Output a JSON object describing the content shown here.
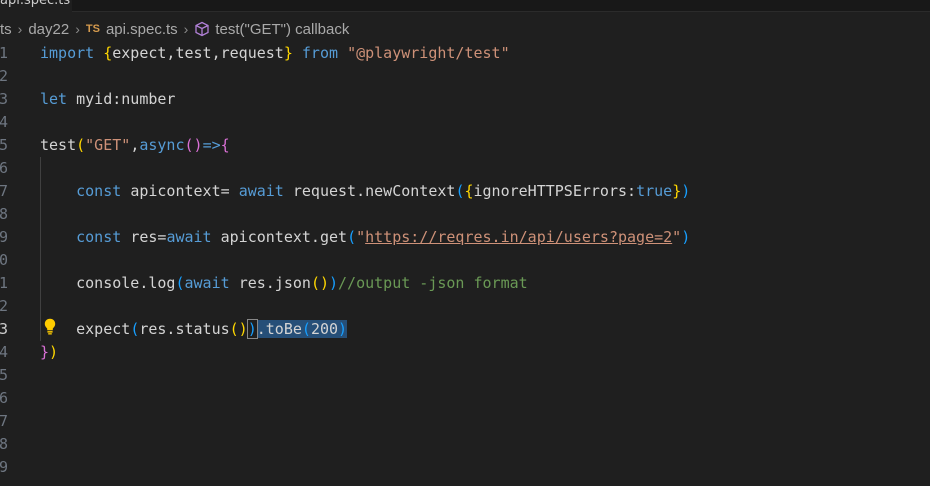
{
  "tab": {
    "label": "api.spec.ts"
  },
  "breadcrumb": {
    "items": [
      {
        "label": "ts"
      },
      {
        "label": "day22"
      },
      {
        "label": "api.spec.ts",
        "badge": "TS"
      },
      {
        "label": "test(\"GET\") callback"
      }
    ],
    "separator": "›"
  },
  "editor": {
    "line_numbers": [
      "1",
      "2",
      "3",
      "4",
      "5",
      "6",
      "7",
      "8",
      "9",
      "0",
      "1",
      "2",
      "3",
      "4",
      "5",
      "6",
      "7",
      "8",
      "9"
    ],
    "current_line_index": 12,
    "lines": [
      {
        "tokens": [
          {
            "t": "import ",
            "c": "kw"
          },
          {
            "t": "{",
            "c": "br1"
          },
          {
            "t": "expect,test,request",
            "c": "plain"
          },
          {
            "t": "}",
            "c": "br1"
          },
          {
            "t": " from ",
            "c": "kw"
          },
          {
            "t": "\"@playwright/test\"",
            "c": "str"
          }
        ]
      },
      {
        "tokens": []
      },
      {
        "tokens": [
          {
            "t": "let ",
            "c": "kw"
          },
          {
            "t": "myid:number",
            "c": "plain"
          }
        ]
      },
      {
        "tokens": []
      },
      {
        "tokens": [
          {
            "t": "test",
            "c": "plain"
          },
          {
            "t": "(",
            "c": "br1"
          },
          {
            "t": "\"GET\"",
            "c": "str"
          },
          {
            "t": ",",
            "c": "plain"
          },
          {
            "t": "async",
            "c": "kw"
          },
          {
            "t": "()",
            "c": "br2"
          },
          {
            "t": "=>",
            "c": "kw"
          },
          {
            "t": "{",
            "c": "br2"
          }
        ]
      },
      {
        "tokens": []
      },
      {
        "tokens": [
          {
            "t": "    const ",
            "c": "kw"
          },
          {
            "t": "apicontext= ",
            "c": "plain"
          },
          {
            "t": "await ",
            "c": "kw"
          },
          {
            "t": "request.newContext",
            "c": "plain"
          },
          {
            "t": "(",
            "c": "br3"
          },
          {
            "t": "{",
            "c": "br1"
          },
          {
            "t": "ignoreHTTPSErrors:",
            "c": "plain"
          },
          {
            "t": "true",
            "c": "bool"
          },
          {
            "t": "}",
            "c": "br1"
          },
          {
            "t": ")",
            "c": "br3"
          }
        ]
      },
      {
        "tokens": []
      },
      {
        "tokens": [
          {
            "t": "    const ",
            "c": "kw"
          },
          {
            "t": "res=",
            "c": "plain"
          },
          {
            "t": "await ",
            "c": "kw"
          },
          {
            "t": "apicontext.get",
            "c": "plain"
          },
          {
            "t": "(",
            "c": "br3"
          },
          {
            "t": "\"",
            "c": "str"
          },
          {
            "t": "https://reqres.in/api/users?page=2",
            "c": "url"
          },
          {
            "t": "\"",
            "c": "str"
          },
          {
            "t": ")",
            "c": "br3"
          }
        ]
      },
      {
        "tokens": []
      },
      {
        "tokens": [
          {
            "t": "    console.log",
            "c": "plain"
          },
          {
            "t": "(",
            "c": "br3"
          },
          {
            "t": "await ",
            "c": "kw"
          },
          {
            "t": "res.json",
            "c": "plain"
          },
          {
            "t": "()",
            "c": "br1"
          },
          {
            "t": ")",
            "c": "br3"
          },
          {
            "t": "//output -json format",
            "c": "comment"
          }
        ]
      },
      {
        "tokens": []
      },
      {
        "tokens": [
          {
            "t": "    expect",
            "c": "plain"
          },
          {
            "t": "(",
            "c": "br3"
          },
          {
            "t": "res.status",
            "c": "plain"
          },
          {
            "t": "()",
            "c": "br1"
          },
          {
            "t": ")",
            "c": "br3",
            "box": true
          },
          {
            "t": ".toBe",
            "c": "plain",
            "sel": true
          },
          {
            "t": "(",
            "c": "br3",
            "sel": true
          },
          {
            "t": "200",
            "c": "plain",
            "sel": true
          },
          {
            "t": ")",
            "c": "br3",
            "sel": true
          }
        ]
      },
      {
        "tokens": [
          {
            "t": "}",
            "c": "br2"
          },
          {
            "t": ")",
            "c": "br1"
          }
        ]
      },
      {
        "tokens": []
      },
      {
        "tokens": []
      },
      {
        "tokens": []
      },
      {
        "tokens": []
      },
      {
        "tokens": []
      }
    ]
  },
  "colors": {
    "background": "#1f1f1f",
    "keyword": "#569cd6",
    "string": "#ce9178",
    "comment": "#6a9955",
    "selection": "#264f78",
    "bracket_gold": "#ffd700",
    "bracket_orchid": "#da70d6",
    "bracket_blue": "#179fff"
  },
  "icons": {
    "lightbulb": "lightbulb-icon",
    "callback": "cube-icon"
  }
}
